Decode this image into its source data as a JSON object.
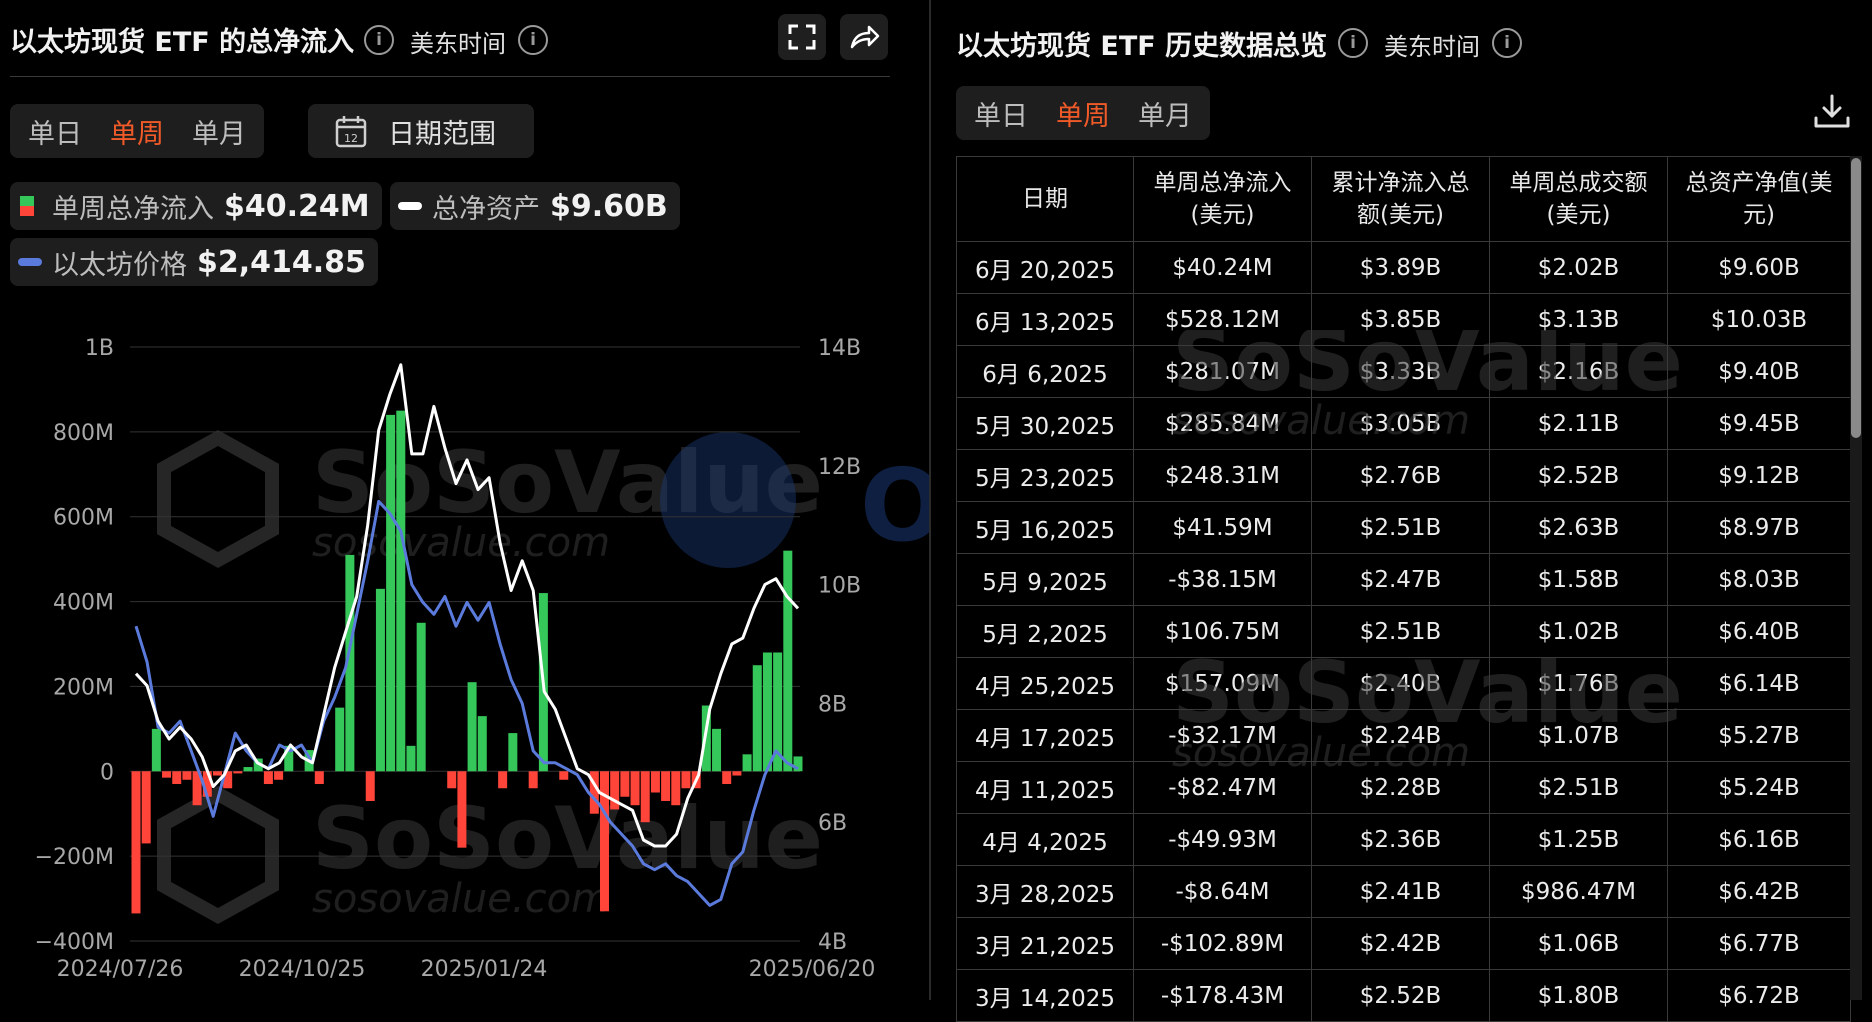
{
  "left_panel": {
    "title": "以太坊现货 ETF 的总净流入",
    "timezone": "美东时间",
    "tabs": [
      {
        "label": "单日",
        "active": false
      },
      {
        "label": "单周",
        "active": true
      },
      {
        "label": "单月",
        "active": false
      }
    ],
    "date_range_label": "日期范围",
    "calendar_day": "12",
    "legend": {
      "net_inflow": {
        "label": "单周总净流入",
        "value": "$40.24M"
      },
      "total_assets": {
        "label": "总净资产",
        "value": "$9.60B"
      },
      "eth_price": {
        "label": "以太坊价格",
        "value": "$2,414.85"
      }
    },
    "icons": {
      "fullscreen": "fullscreen-icon",
      "share": "share-icon",
      "calendar": "calendar-icon"
    }
  },
  "right_panel": {
    "title": "以太坊现货 ETF 历史数据总览",
    "timezone": "美东时间",
    "tabs": [
      {
        "label": "单日",
        "active": false
      },
      {
        "label": "单周",
        "active": true
      },
      {
        "label": "单月",
        "active": false
      }
    ],
    "download_icon": "download-icon",
    "table": {
      "headers": [
        "日期",
        "单周总净流入\n(美元)",
        "累计净流入总\n额(美元)",
        "单周总成交额\n(美元)",
        "总资产净值(美\n元)"
      ],
      "rows": [
        [
          "6月 20,2025",
          "$40.24M",
          "$3.89B",
          "$2.02B",
          "$9.60B"
        ],
        [
          "6月 13,2025",
          "$528.12M",
          "$3.85B",
          "$3.13B",
          "$10.03B"
        ],
        [
          "6月 6,2025",
          "$281.07M",
          "$3.33B",
          "$2.16B",
          "$9.40B"
        ],
        [
          "5月 30,2025",
          "$285.84M",
          "$3.05B",
          "$2.11B",
          "$9.45B"
        ],
        [
          "5月 23,2025",
          "$248.31M",
          "$2.76B",
          "$2.52B",
          "$9.12B"
        ],
        [
          "5月 16,2025",
          "$41.59M",
          "$2.51B",
          "$2.63B",
          "$8.97B"
        ],
        [
          "5月 9,2025",
          "-$38.15M",
          "$2.47B",
          "$1.58B",
          "$8.03B"
        ],
        [
          "5月 2,2025",
          "$106.75M",
          "$2.51B",
          "$1.02B",
          "$6.40B"
        ],
        [
          "4月 25,2025",
          "$157.09M",
          "$2.40B",
          "$1.76B",
          "$6.14B"
        ],
        [
          "4月 17,2025",
          "-$32.17M",
          "$2.24B",
          "$1.07B",
          "$5.27B"
        ],
        [
          "4月 11,2025",
          "-$82.47M",
          "$2.28B",
          "$2.51B",
          "$5.24B"
        ],
        [
          "4月 4,2025",
          "-$49.93M",
          "$2.36B",
          "$1.25B",
          "$6.16B"
        ],
        [
          "3月 28,2025",
          "-$8.64M",
          "$2.41B",
          "$986.47M",
          "$6.42B"
        ],
        [
          "3月 21,2025",
          "-$102.89M",
          "$2.42B",
          "$1.06B",
          "$6.77B"
        ],
        [
          "3月 14,2025",
          "-$178.43M",
          "$2.52B",
          "$1.80B",
          "$6.72B"
        ]
      ]
    }
  },
  "watermarks": {
    "brand": "SoSoValue",
    "url": "sosovalue.com",
    "odaily": "ODAILY"
  },
  "colors": {
    "accent": "#f05a28",
    "positive": "#35c759",
    "negative": "#ff453a",
    "line_assets": "#ffffff",
    "line_price": "#5b7bdc"
  },
  "chart_data": {
    "type": "bar",
    "x_tick_labels": [
      "2024/07/26",
      "2024/10/25",
      "2025/01/24",
      "2025/06/20"
    ],
    "y_left": {
      "ticks": [
        "1B",
        "800M",
        "600M",
        "400M",
        "200M",
        "0",
        "−200M",
        "−400M"
      ],
      "range": [
        -400,
        1000
      ],
      "unit": "M"
    },
    "y_right": {
      "ticks": [
        "14B",
        "12B",
        "10B",
        "8B",
        "6B",
        "4B"
      ],
      "range": [
        4,
        14
      ],
      "unit": "B"
    },
    "grid": true,
    "series": [
      {
        "name": "单周总净流入",
        "type": "bar",
        "unit": "M",
        "values": [
          -335,
          -170,
          100,
          -15,
          -30,
          -20,
          -80,
          -60,
          -10,
          -40,
          -5,
          10,
          30,
          -30,
          -20,
          60,
          0,
          50,
          -30,
          0,
          150,
          510,
          0,
          -70,
          430,
          840,
          850,
          60,
          350,
          0,
          0,
          -40,
          -180,
          210,
          130,
          0,
          -40,
          90,
          0,
          -40,
          420,
          0,
          -20,
          0,
          0,
          -100,
          -330,
          -90,
          -60,
          -80,
          -120,
          -50,
          -70,
          -80,
          -40,
          -40,
          155,
          100,
          -30,
          -10,
          40,
          250,
          280,
          280,
          520,
          35
        ]
      },
      {
        "name": "总净资产",
        "type": "line",
        "unit": "B",
        "values": [
          8.5,
          8.3,
          7.7,
          7.4,
          7.6,
          7.4,
          7.1,
          6.6,
          6.8,
          7.2,
          7.3,
          7.0,
          6.9,
          7.0,
          7.3,
          7.1,
          7.0,
          7.8,
          8.6,
          9.2,
          9.8,
          11.0,
          12.6,
          13.2,
          13.7,
          12.2,
          12.2,
          13.0,
          12.3,
          11.7,
          12.1,
          11.6,
          11.8,
          10.7,
          9.9,
          10.4,
          9.9,
          8.2,
          7.9,
          7.4,
          6.9,
          6.8,
          6.5,
          6.4,
          6.3,
          6.2,
          5.7,
          5.6,
          5.6,
          5.8,
          6.4,
          6.8,
          7.9,
          8.5,
          9.0,
          9.1,
          9.6,
          10.0,
          10.1,
          9.8,
          9.6
        ]
      },
      {
        "name": "以太坊价格",
        "unit": "B",
        "type": "line",
        "values": [
          9.3,
          8.7,
          7.6,
          7.5,
          7.7,
          7.2,
          6.7,
          6.1,
          6.8,
          7.5,
          7.2,
          7.0,
          6.9,
          7.3,
          7.2,
          7.3,
          7.0,
          7.7,
          8.1,
          8.6,
          9.5,
          10.4,
          11.4,
          11.2,
          10.9,
          10.0,
          9.7,
          9.5,
          9.8,
          9.3,
          9.7,
          9.4,
          9.7,
          9.0,
          8.4,
          8.0,
          7.2,
          7.0,
          7.0,
          6.9,
          6.8,
          6.5,
          6.3,
          6.0,
          5.8,
          5.6,
          5.3,
          5.2,
          5.3,
          5.1,
          5.0,
          4.8,
          4.6,
          4.7,
          5.3,
          5.5,
          6.2,
          6.8,
          7.2,
          7.0,
          6.9
        ]
      }
    ]
  }
}
